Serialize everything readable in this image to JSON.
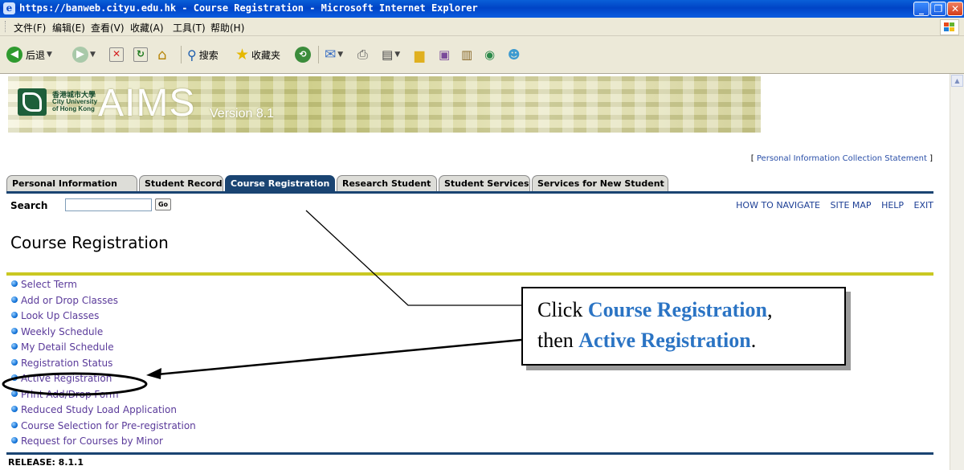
{
  "window": {
    "title": "https://banweb.cityu.edu.hk - Course Registration - Microsoft Internet Explorer",
    "controls": [
      "_",
      "❐",
      "✕"
    ]
  },
  "menubar": {
    "items": [
      "文件(F)",
      "编辑(E)",
      "查看(V)",
      "收藏(A)",
      "工具(T)",
      "帮助(H)"
    ]
  },
  "toolbar": {
    "back_label": "后退",
    "search_label": "搜索",
    "favorites_label": "收藏夹"
  },
  "banner": {
    "university_cn": "香港城市大學",
    "university_en_line1": "City University",
    "university_en_line2": "of Hong Kong",
    "app_name": "AIMS",
    "version": "Version 8.1"
  },
  "pics_link": {
    "open": "[ ",
    "label": "Personal Information Collection Statement",
    "close": " ]"
  },
  "tabs": [
    {
      "label": "Personal Information",
      "active": false
    },
    {
      "label": "Student Record",
      "active": false
    },
    {
      "label": "Course Registration",
      "active": true
    },
    {
      "label": "Research Student",
      "active": false
    },
    {
      "label": "Student Services",
      "active": false
    },
    {
      "label": "Services for New Student",
      "active": false
    }
  ],
  "search": {
    "label": "Search",
    "value": "",
    "go_label": "Go"
  },
  "top_links": [
    "HOW TO NAVIGATE",
    "SITE MAP",
    "HELP",
    "EXIT"
  ],
  "page_title": "Course Registration",
  "menu_items": [
    "Select Term",
    "Add or Drop Classes",
    "Look Up Classes",
    "Weekly Schedule",
    "My Detail Schedule",
    "Registration Status",
    "Active Registration",
    "Print Add/Drop Form",
    "Reduced Study Load Application",
    "Course Selection for Pre-registration",
    "Request for Courses by Minor"
  ],
  "release": "RELEASE: 8.1.1",
  "callout": {
    "line1_prefix": "Click ",
    "line1_highlight": "Course Registration",
    "line1_suffix": ",",
    "line2_prefix": "then ",
    "line2_highlight": "Active Registration",
    "line2_suffix": "."
  },
  "colors": {
    "tab_active": "#1a4472",
    "yellow_rule": "#c9c822",
    "link": "#5a3a9a",
    "callout_highlight": "#2b74c4"
  }
}
